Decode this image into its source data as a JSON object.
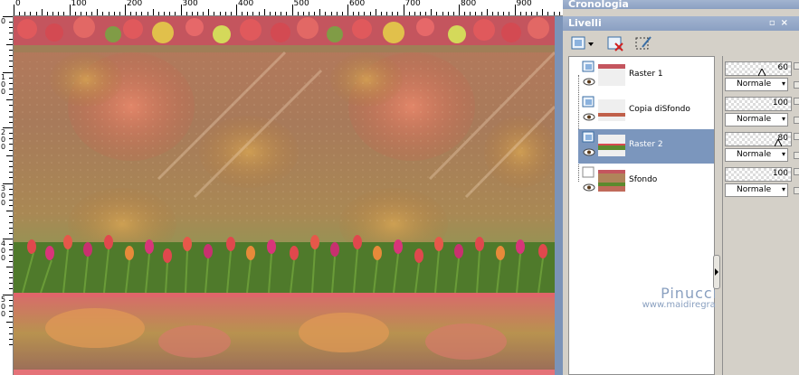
{
  "panels": {
    "history_title": "Cronologia",
    "layers_title": "Livelli"
  },
  "ruler": {
    "marks": [
      "0",
      "100",
      "200",
      "300",
      "400",
      "500",
      "600",
      "700",
      "800",
      "900"
    ],
    "left_marks": [
      "0",
      "100",
      "200",
      "300",
      "400",
      "500"
    ]
  },
  "toolbar": {
    "new_layer_icon": "new-layer-icon",
    "delete_layer_icon": "delete-layer-icon",
    "edit_icon": "edit-selection-icon"
  },
  "layers": [
    {
      "name": "Raster 1",
      "opacity": "60",
      "blend": "Normale",
      "selected": false,
      "thumb": "raster1"
    },
    {
      "name": "Copia diSfondo",
      "opacity": "100",
      "blend": "Normale",
      "selected": false,
      "thumb": "copy"
    },
    {
      "name": "Raster 2",
      "opacity": "80",
      "blend": "Normale",
      "selected": true,
      "thumb": "raster2"
    },
    {
      "name": "Sfondo",
      "opacity": "100",
      "blend": "Normale",
      "selected": false,
      "thumb": "bg"
    }
  ],
  "watermark": {
    "name": "Pinuccia",
    "url": "www.maidiregrafica.eu"
  },
  "colors": {
    "selection": "#7b96bd",
    "panel_bg": "#d4d0c8",
    "title_bar": "#8ba0c2"
  }
}
